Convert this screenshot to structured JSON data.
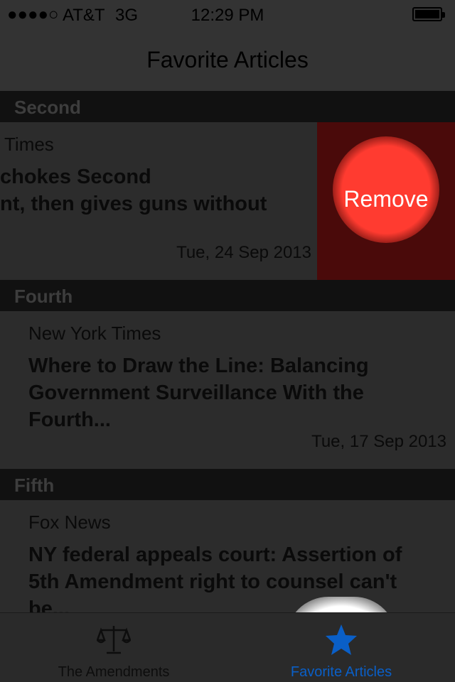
{
  "status_bar": {
    "signal": "●●●●○",
    "carrier": "AT&T",
    "network": "3G",
    "time": "12:29 PM"
  },
  "nav": {
    "title": "Favorite Articles"
  },
  "sections": [
    {
      "header": "Second",
      "article": {
        "source": "Times",
        "headline": "chokes Second nt, then gives guns without",
        "date": "Tue, 24 Sep 2013",
        "action_label": "Remove"
      }
    },
    {
      "header": "Fourth",
      "article": {
        "source": "New York Times",
        "headline": "Where to Draw the Line: Balancing Government Surveillance With the Fourth...",
        "date": "Tue, 17 Sep 2013"
      }
    },
    {
      "header": "Fifth",
      "article": {
        "source": "Fox News",
        "headline": "NY federal appeals court: Assertion of 5th Amendment right to counsel can't be..."
      }
    }
  ],
  "tabs": [
    {
      "label": "The Amendments",
      "icon": "scales-icon"
    },
    {
      "label": "Favorite Articles",
      "icon": "star-icon",
      "selected": true
    }
  ],
  "colors": {
    "accent": "#0a5fc7",
    "remove": "#ff3b30",
    "section_header": "#111111"
  }
}
